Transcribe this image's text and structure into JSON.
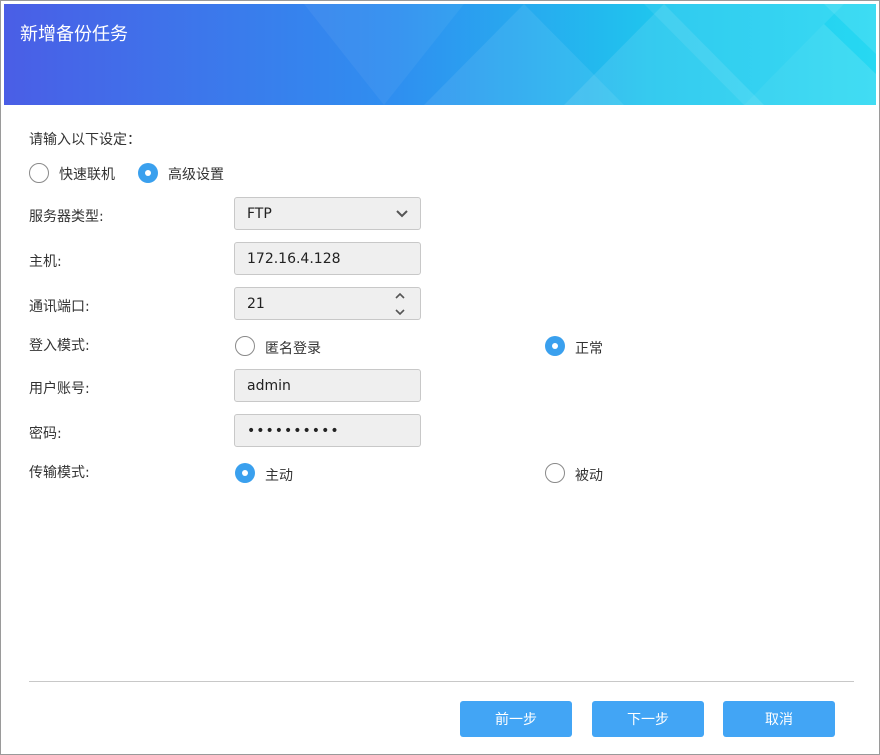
{
  "dialog": {
    "title": "新增备份任务"
  },
  "form": {
    "prompt": "请输入以下设定：",
    "setup_mode": {
      "options": [
        "快速联机",
        "高级设置"
      ],
      "selected": 1
    },
    "server_type": {
      "label": "服务器类型:",
      "value": "FTP"
    },
    "host": {
      "label": "主机:",
      "value": "172.16.4.128"
    },
    "port": {
      "label": "通讯端口:",
      "value": "21"
    },
    "login_mode": {
      "label": "登入模式:",
      "options": [
        "匿名登录",
        "正常"
      ],
      "selected": 1
    },
    "username": {
      "label": "用户账号:",
      "value": "admin"
    },
    "password": {
      "label": "密码:",
      "value": "••••••••••"
    },
    "transfer_mode": {
      "label": "传输模式:",
      "options": [
        "主动",
        "被动"
      ],
      "selected": 0
    }
  },
  "buttons": {
    "prev": "前一步",
    "next": "下一步",
    "cancel": "取消"
  },
  "colors": {
    "accent": "#3aa0ee",
    "button": "#42a5f5",
    "header_start": "#4a5ee6",
    "header_end": "#27d8f2"
  },
  "icons": {
    "dropdown": "chevron-down-icon",
    "spin_up": "chevron-up-icon",
    "spin_down": "chevron-down-icon"
  }
}
